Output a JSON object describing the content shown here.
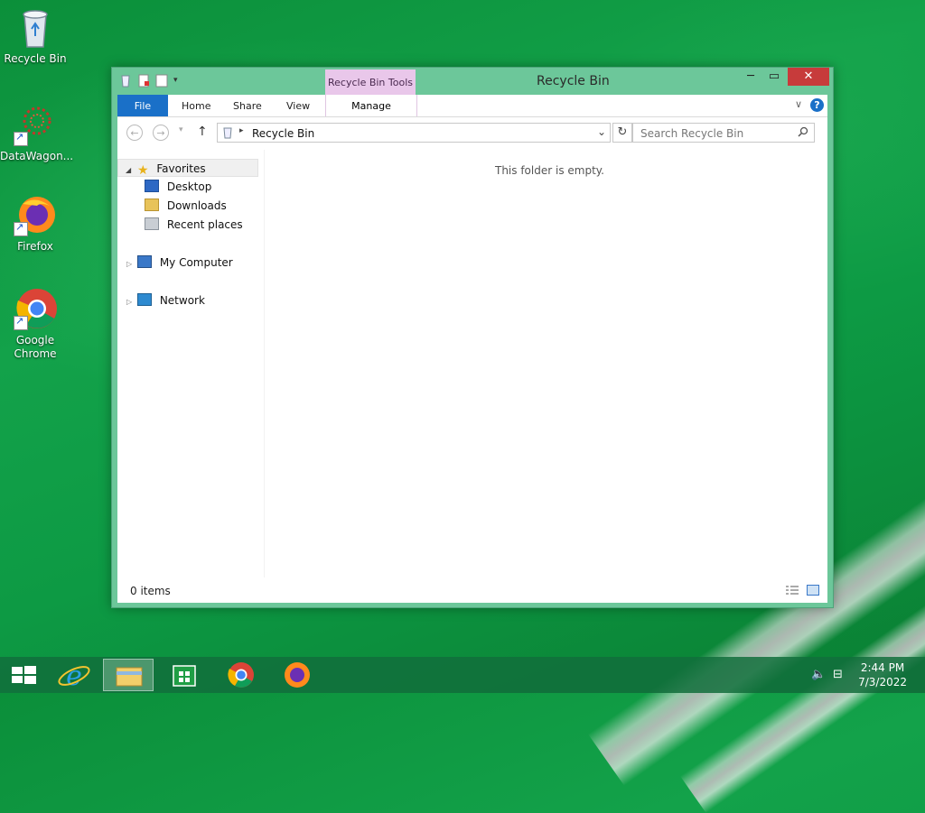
{
  "desktop": {
    "icons": [
      {
        "label": "Recycle Bin"
      },
      {
        "label": "DataWagon..."
      },
      {
        "label": "Firefox"
      },
      {
        "label": "Google Chrome"
      }
    ]
  },
  "window": {
    "title": "Recycle Bin",
    "contextual_tab_header": "Recycle Bin Tools",
    "ribbon_tabs": [
      "File",
      "Home",
      "Share",
      "View"
    ],
    "contextual_tab": "Manage",
    "address": "Recycle Bin",
    "search_placeholder": "Search Recycle Bin",
    "nav": {
      "favorites": "Favorites",
      "desktop": "Desktop",
      "downloads": "Downloads",
      "recent": "Recent places",
      "computer": "My Computer",
      "network": "Network"
    },
    "empty_message": "This folder is empty.",
    "status": "0 items"
  },
  "taskbar": {
    "time": "2:44 PM",
    "date": "7/3/2022"
  },
  "colors": {
    "file_tab": "#1a70c8",
    "contextual": "#e9c7ea",
    "close": "#c73b3b"
  }
}
